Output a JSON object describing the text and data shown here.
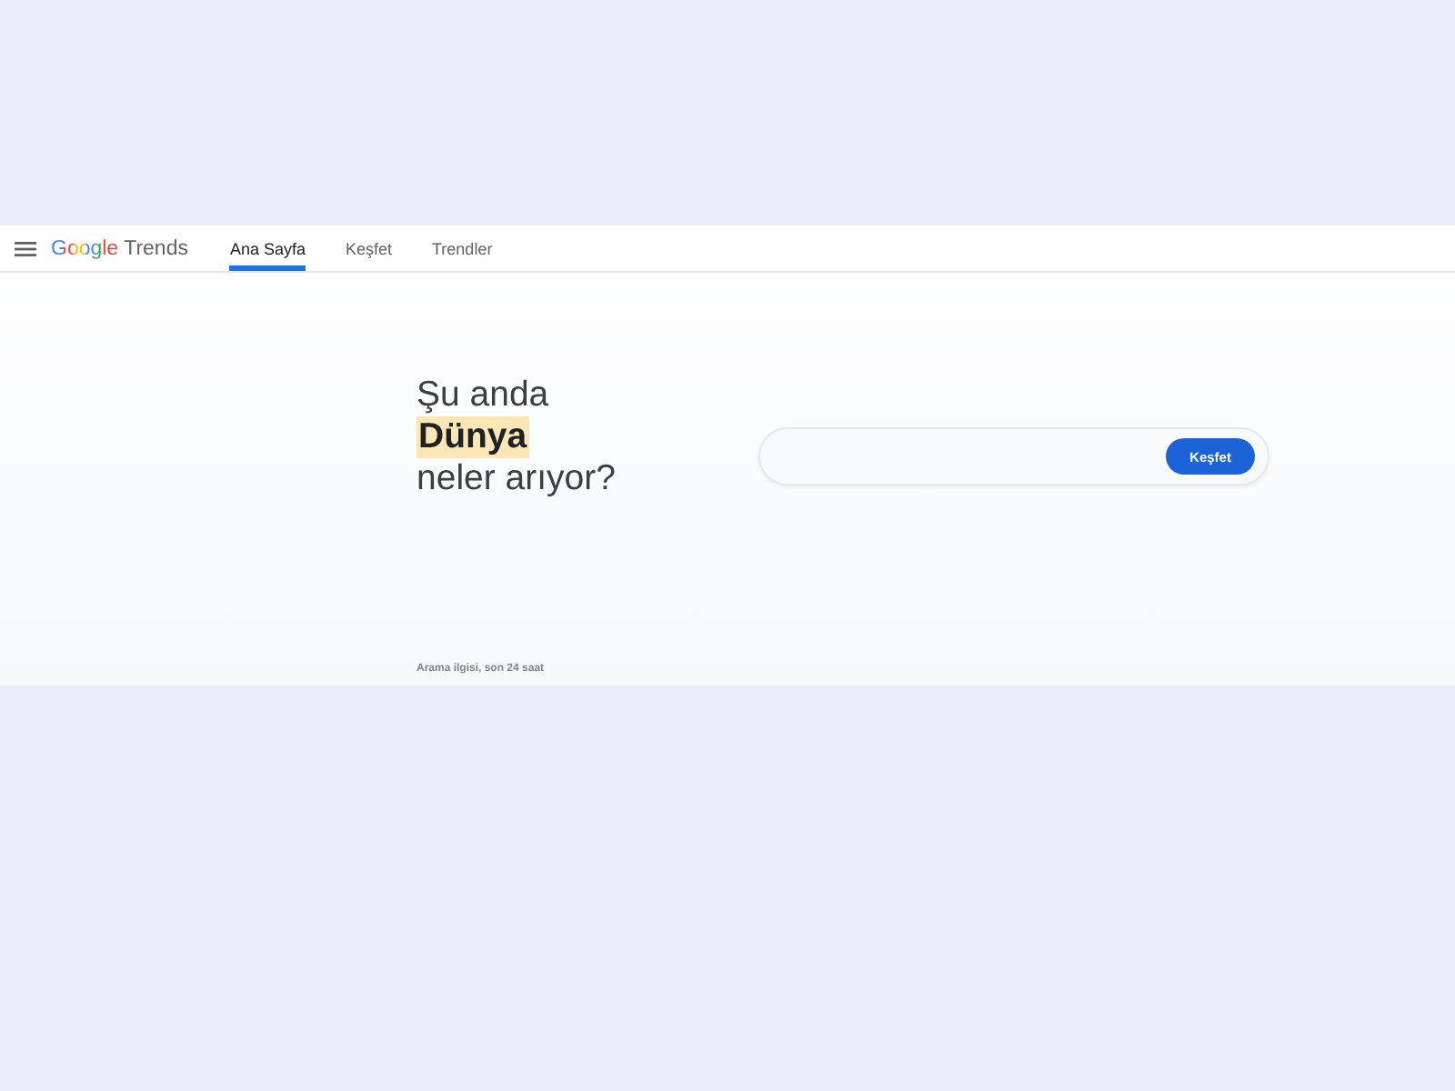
{
  "header": {
    "logo": {
      "brand": "Google",
      "product": "Trends"
    },
    "tabs": [
      {
        "label": "Ana Sayfa",
        "selected": true
      },
      {
        "label": "Keşfet",
        "selected": false
      },
      {
        "label": "Trendler",
        "selected": false
      }
    ]
  },
  "hero": {
    "heading": "Şu anda **Dünya** neler arıyor?",
    "search": {
      "button": "Keşfet"
    },
    "caption": "Arama ilgisi, son 24 saat"
  }
}
